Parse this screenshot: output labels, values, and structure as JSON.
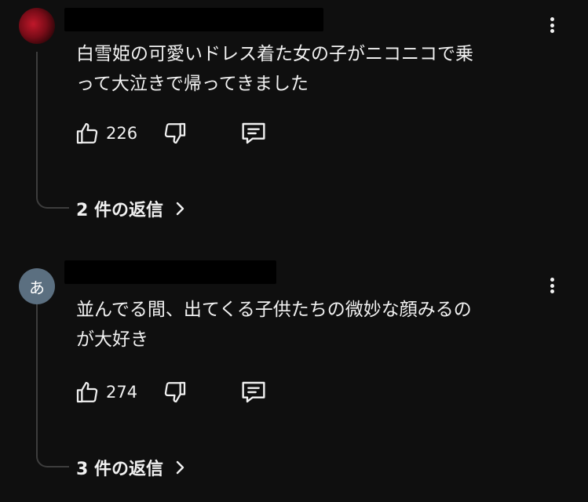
{
  "comments": [
    {
      "avatar_letter": "",
      "text": "白雪姫の可愛いドレス着た女の子がニコニコで乗\nって大泣きで帰ってきました",
      "likes": "226",
      "replies_label": "2 件の返信"
    },
    {
      "avatar_letter": "あ",
      "text": "並んでる間、出てくる子供たちの微妙な顔みるの\nが大好き",
      "likes": "274",
      "replies_label": "3 件の返信"
    }
  ],
  "icons": {
    "like": "thumbs-up-icon",
    "dislike": "thumbs-down-icon",
    "reply": "comment-icon",
    "more": "more-vertical-icon",
    "chevron": "chevron-right-icon"
  },
  "colors": {
    "background": "#0f0f0f",
    "text": "#f1f1f1",
    "thread_line": "#3d3d3d",
    "avatar_letter_bg": "#5b6f80"
  }
}
